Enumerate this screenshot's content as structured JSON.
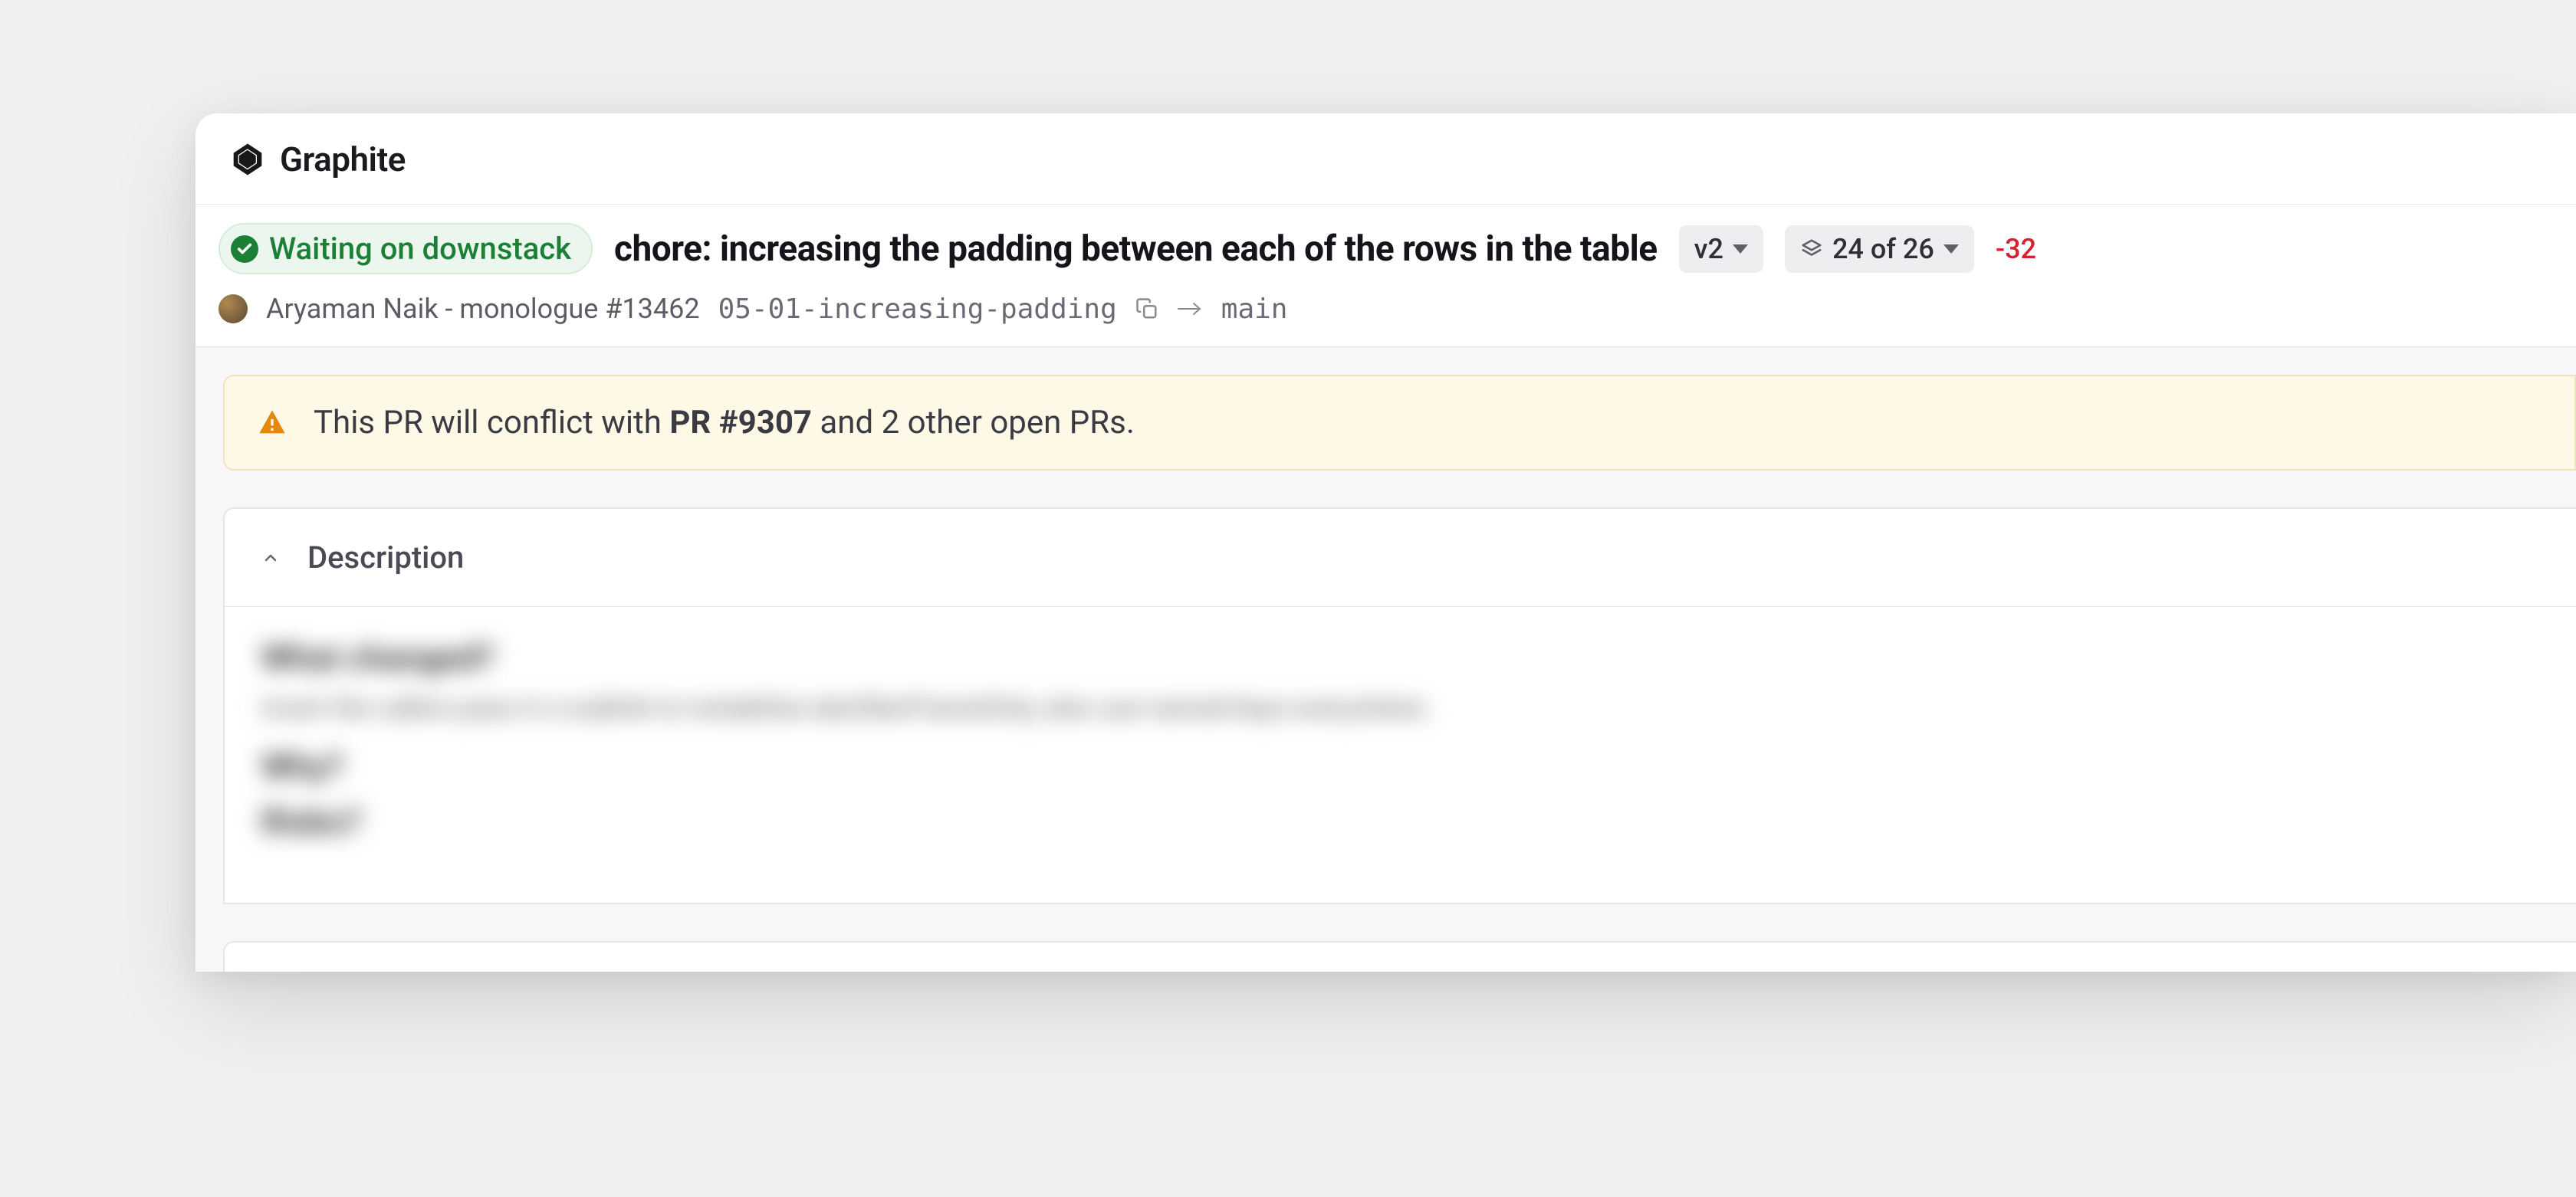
{
  "app": {
    "name": "Graphite"
  },
  "status": {
    "label": "Waiting on downstack"
  },
  "pr": {
    "title": "chore: increasing the padding between each of the rows in the table",
    "author_label": "Aryaman Naik - monologue #13462",
    "branch": "05-01-increasing-padding",
    "target_branch": "main"
  },
  "version": {
    "label": "v2"
  },
  "stack": {
    "label": "24 of 26"
  },
  "diff": {
    "neg": "-32"
  },
  "warning": {
    "prefix": "This PR will conflict with ",
    "pr_ref": "PR #9307",
    "suffix": " and 2 other open PRs."
  },
  "description": {
    "heading": "Description",
    "blurred": {
      "h1": "What changed?",
      "p1": "Invert the callers pass in a sublink to instabilize absOberFrameOnly, also use named keys everywhere.",
      "h2": "Why?",
      "h3": "Risks?"
    }
  }
}
